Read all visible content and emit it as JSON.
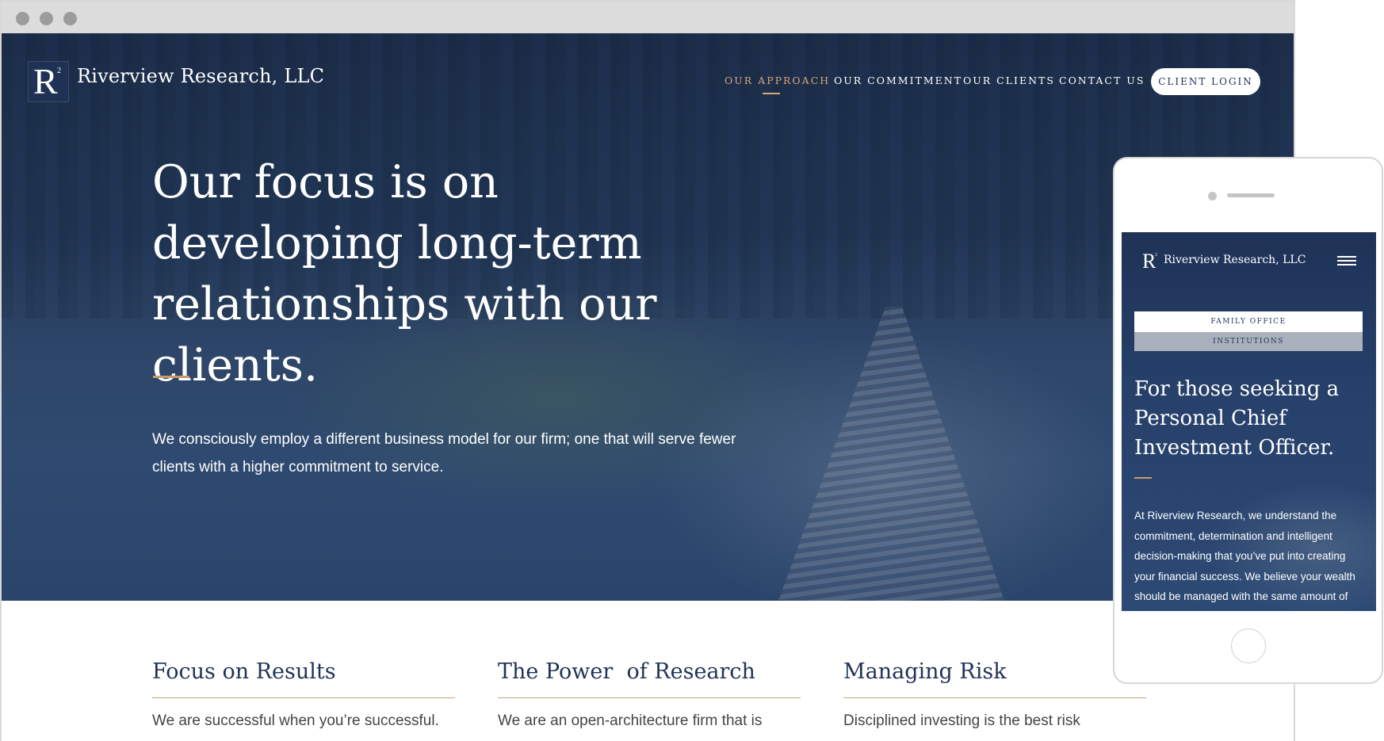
{
  "site": {
    "brand": "Riverview Research, LLC",
    "logo_letter": "R",
    "logo_superscript": "2"
  },
  "nav": {
    "items": [
      "OUR APPROACH",
      "OUR COMMITMENT",
      "OUR CLIENTS",
      "CONTACT US"
    ],
    "active": "OUR APPROACH",
    "login": "CLIENT LOGIN"
  },
  "hero": {
    "title": "Our focus is on developing long-term relationships with our clients.",
    "body": "We consciously employ a different business model for our firm; one that will serve fewer clients with a higher commitment to service."
  },
  "features": [
    {
      "title": "Focus on Results",
      "text": "We are successful when you’re successful."
    },
    {
      "title": "The Power  of Research",
      "text": "We are an open-architecture firm that is"
    },
    {
      "title": "Managing Risk",
      "text": "Disciplined investing is the best risk"
    }
  ],
  "mobile": {
    "brand": "Riverview Research, LLC",
    "tabs": [
      "FAMILY OFFICE",
      "INSTITUTIONS"
    ],
    "title": "For those seeking a Personal Chief Investment Officer.",
    "body": "At Riverview Research, we understand the commitment, determination and intelligent decision-making that you’ve put into creating your financial success. We believe your wealth should be managed with the same amount of"
  },
  "colors": {
    "navy": "#1f3256",
    "accent": "#d7a877",
    "rule": "#c6a57d"
  },
  "icons": [
    "window-close-dot-icon",
    "window-minimize-dot-icon",
    "window-zoom-dot-icon",
    "hamburger-menu-icon"
  ]
}
